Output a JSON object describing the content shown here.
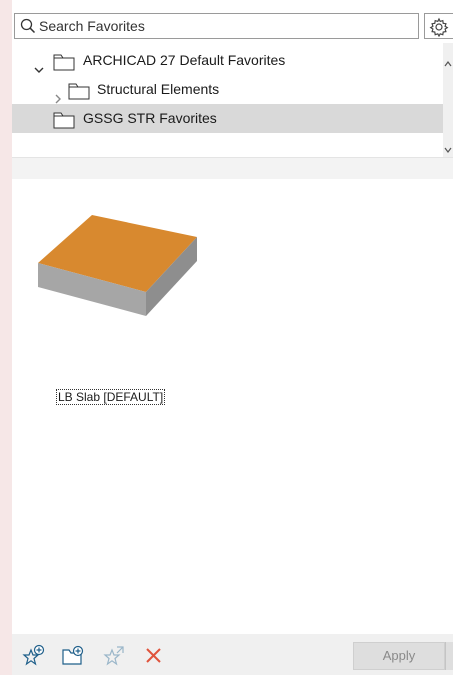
{
  "search": {
    "placeholder": "Search Favorites"
  },
  "tree": {
    "items": [
      {
        "label": "ARCHICAD 27 Default Favorites",
        "expanded": true,
        "icon": "folder-icon"
      },
      {
        "label": "Structural Elements",
        "expanded": false,
        "icon": "folder-icon"
      },
      {
        "label": "GSSG STR Favorites",
        "selected": true,
        "icon": "folder-icon"
      }
    ]
  },
  "content": {
    "favorites": [
      {
        "label": "LB Slab [DEFAULT]",
        "icon": "slab-thumbnail"
      }
    ]
  },
  "toolbar": {
    "icons": [
      "new-favorite-icon",
      "new-folder-icon",
      "redefine-favorite-icon",
      "delete-icon"
    ],
    "apply_label": "Apply"
  },
  "colors": {
    "slab_top": "#d8892f",
    "slab_side": "#a6a6a6",
    "selection": "#d9d9d9",
    "delete_red": "#e0533c"
  }
}
